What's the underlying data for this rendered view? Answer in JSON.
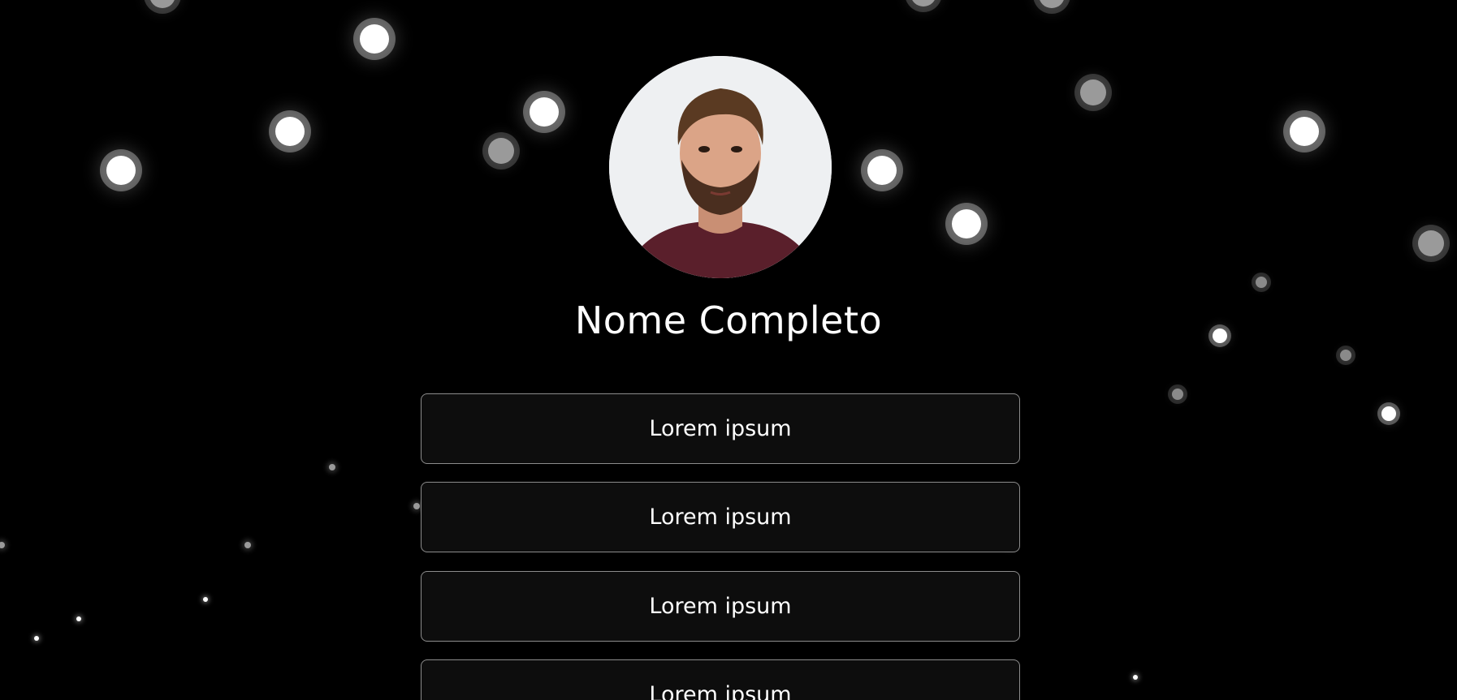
{
  "profile": {
    "name": "Nome Completo",
    "avatar_alt": "profile photo"
  },
  "links": [
    {
      "label": "Lorem ipsum"
    },
    {
      "label": "Lorem ipsum"
    },
    {
      "label": "Lorem ipsum"
    },
    {
      "label": "Lorem ipsum"
    }
  ],
  "theme": {
    "background": "#000000",
    "button_background": "#0d0d0d",
    "button_border": "#8c8c8c",
    "text": "#ffffff"
  }
}
